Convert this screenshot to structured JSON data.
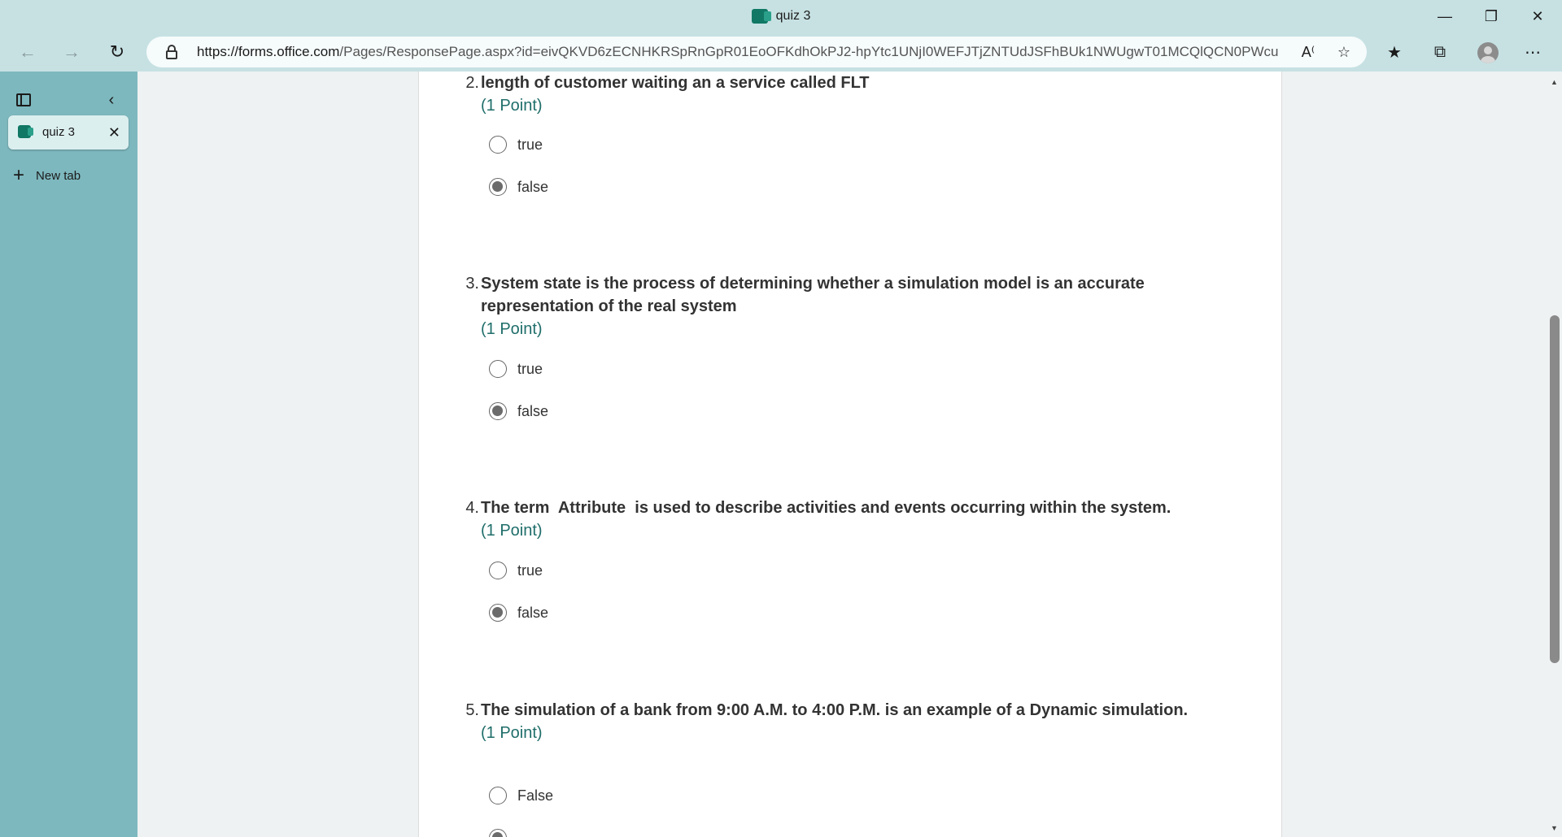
{
  "window": {
    "title": "quiz 3",
    "minimize_icon": "minimize-icon",
    "restore_icon": "restore-icon",
    "close_icon": "close-icon"
  },
  "addressbar": {
    "url_host": "https://forms.office.com",
    "url_rest": "/Pages/ResponsePage.aspx?id=eivQKVD6zECNHKRSpRnGpR01EoOFKdhOkPJ2-hpYtc1UNjI0WEFJTjZNTUdJSFhBUk1NWUgwT01MCQlQCN0PWcu"
  },
  "sidebar": {
    "active_tab": "quiz 3",
    "new_tab_label": "New tab"
  },
  "questions": [
    {
      "number": "2.",
      "text": "length of customer waiting an a service called FLT",
      "points": "(1 Point)",
      "options": [
        {
          "label": "true",
          "checked": false
        },
        {
          "label": "false",
          "checked": true
        }
      ]
    },
    {
      "number": "3.",
      "text": "System state is the process of determining whether a simulation model is an accurate representation of the real system",
      "points": "(1 Point)",
      "options": [
        {
          "label": "true",
          "checked": false
        },
        {
          "label": "false",
          "checked": true
        }
      ]
    },
    {
      "number": "4.",
      "text": "The term  Attribute  is used to describe activities and events occurring within the system.",
      "points": "(1 Point)",
      "options": [
        {
          "label": "true",
          "checked": false
        },
        {
          "label": "false",
          "checked": true
        }
      ]
    },
    {
      "number": "5.",
      "text": "The simulation of a bank from 9:00 A.M. to 4:00 P.M. is an example of a Dynamic simulation.",
      "points": "(1 Point)",
      "options": [
        {
          "label": "False",
          "checked": false
        },
        {
          "label": "",
          "checked": true
        }
      ]
    }
  ],
  "colors": {
    "accent_teal": "#1f6e6a",
    "chrome": "#c7e1e3",
    "sidebar": "#7db8be"
  }
}
